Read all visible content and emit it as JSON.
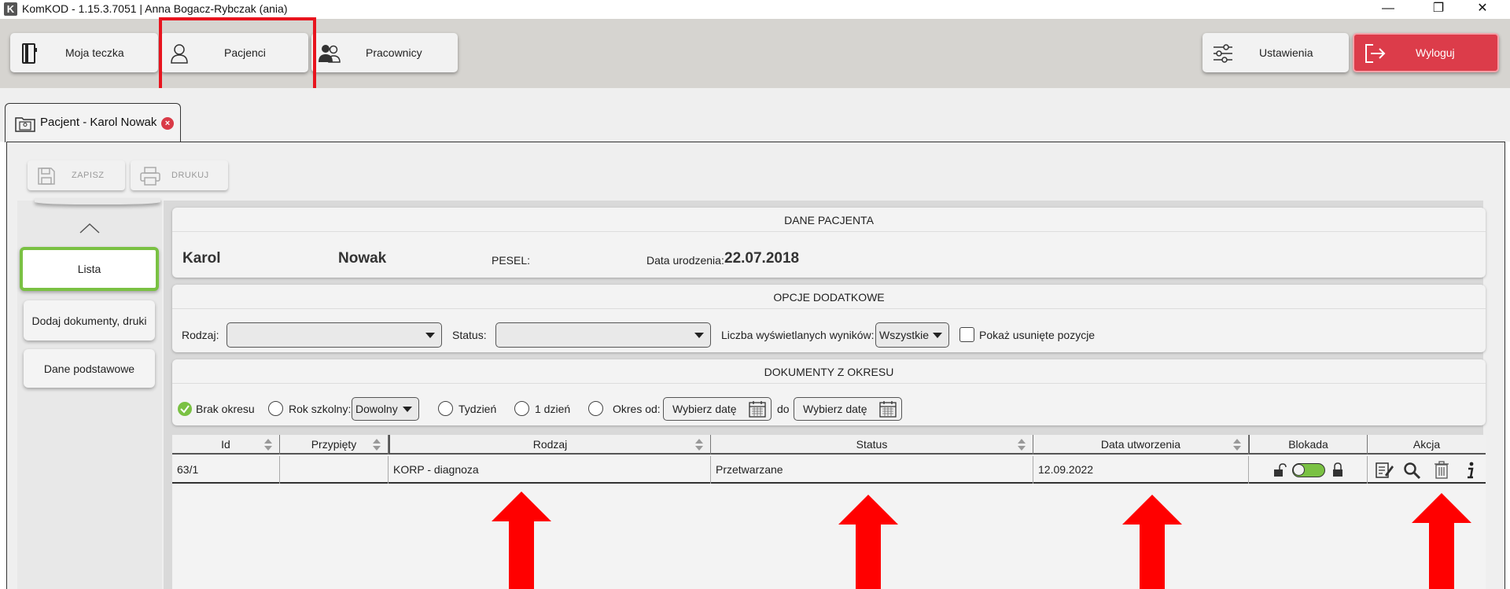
{
  "window": {
    "logo": "K",
    "title": "KomKOD - 1.15.3.7051 | Anna Bogacz-Rybczak (ania)",
    "controls": {
      "minimize": "—",
      "restore": "❐",
      "close": "✕"
    }
  },
  "toolbar": {
    "moja_teczka": "Moja teczka",
    "pacjenci": "Pacjenci",
    "pracownicy": "Pracownicy",
    "ustawienia": "Ustawienia",
    "wyloguj": "Wyloguj"
  },
  "tab": {
    "title": "Pacjent - Karol Nowak",
    "close": "×"
  },
  "actions": {
    "zapisz": "ZAPISZ",
    "drukuj": "DRUKUJ"
  },
  "sidebar": {
    "items": [
      {
        "label": "Lista"
      },
      {
        "label": "Dodaj dokumenty, druki"
      },
      {
        "label": "Dane podstawowe"
      }
    ]
  },
  "patient": {
    "section_title": "DANE PACJENTA",
    "first_name": "Karol",
    "last_name": "Nowak",
    "pesel_label": "PESEL:",
    "pesel_value": "",
    "birth_label": "Data urodzenia:",
    "birth_value": "22.07.2018"
  },
  "options": {
    "section_title": "OPCJE DODATKOWE",
    "rodzaj_label": "Rodzaj:",
    "rodzaj_value": "",
    "status_label": "Status:",
    "status_value": "",
    "results_label": "Liczba wyświetlanych wyników:",
    "results_value": "Wszystkie",
    "show_deleted_label": "Pokaż usunięte pozycje"
  },
  "period": {
    "section_title": "DOKUMENTY Z OKRESU",
    "brak_okresu": "Brak okresu",
    "rok_szkolny": "Rok szkolny:",
    "rok_szkolny_value": "Dowolny",
    "tydzien": "Tydzień",
    "jeden_dzien": "1 dzień",
    "okres_od": "Okres od:",
    "date_placeholder": "Wybierz datę",
    "do": "do"
  },
  "table": {
    "columns": [
      "Id",
      "Przypięty",
      "Rodzaj",
      "Status",
      "Data utworzenia",
      "Blokada",
      "Akcja"
    ],
    "rows": [
      {
        "id": "63/1",
        "przypiety": "",
        "rodzaj": "KORP - diagnoza",
        "status": "Przetwarzane",
        "data": "12.09.2022"
      }
    ]
  },
  "colors": {
    "accent_green": "#7ac143",
    "logout_red": "#dc3c4a",
    "highlight_red": "#e8141e",
    "arrow_red": "#ff0000",
    "toolbar_bg": "#d6d4d0"
  }
}
